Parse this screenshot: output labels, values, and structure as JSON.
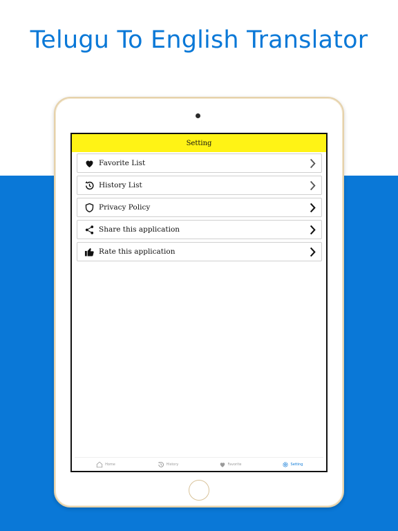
{
  "headline": "Telugu To English Translator",
  "app": {
    "title": "Setting",
    "menu": [
      {
        "label": "Favorite List",
        "icon": "heart-icon"
      },
      {
        "label": "History List",
        "icon": "history-icon"
      },
      {
        "label": "Privacy Policy",
        "icon": "shield-icon"
      },
      {
        "label": "Share this application",
        "icon": "share-icon"
      },
      {
        "label": "Rate this application",
        "icon": "thumbs-up-icon"
      }
    ],
    "bottom_nav": [
      {
        "label": "Home",
        "icon": "home-icon"
      },
      {
        "label": "History",
        "icon": "history-icon"
      },
      {
        "label": "Favorite",
        "icon": "heart-icon"
      },
      {
        "label": "Setting",
        "icon": "gear-icon",
        "active": true
      }
    ]
  },
  "colors": {
    "brand_blue": "#0a78d7",
    "top_bar_yellow": "#fff315",
    "device_frame": "#e6d2ab"
  }
}
